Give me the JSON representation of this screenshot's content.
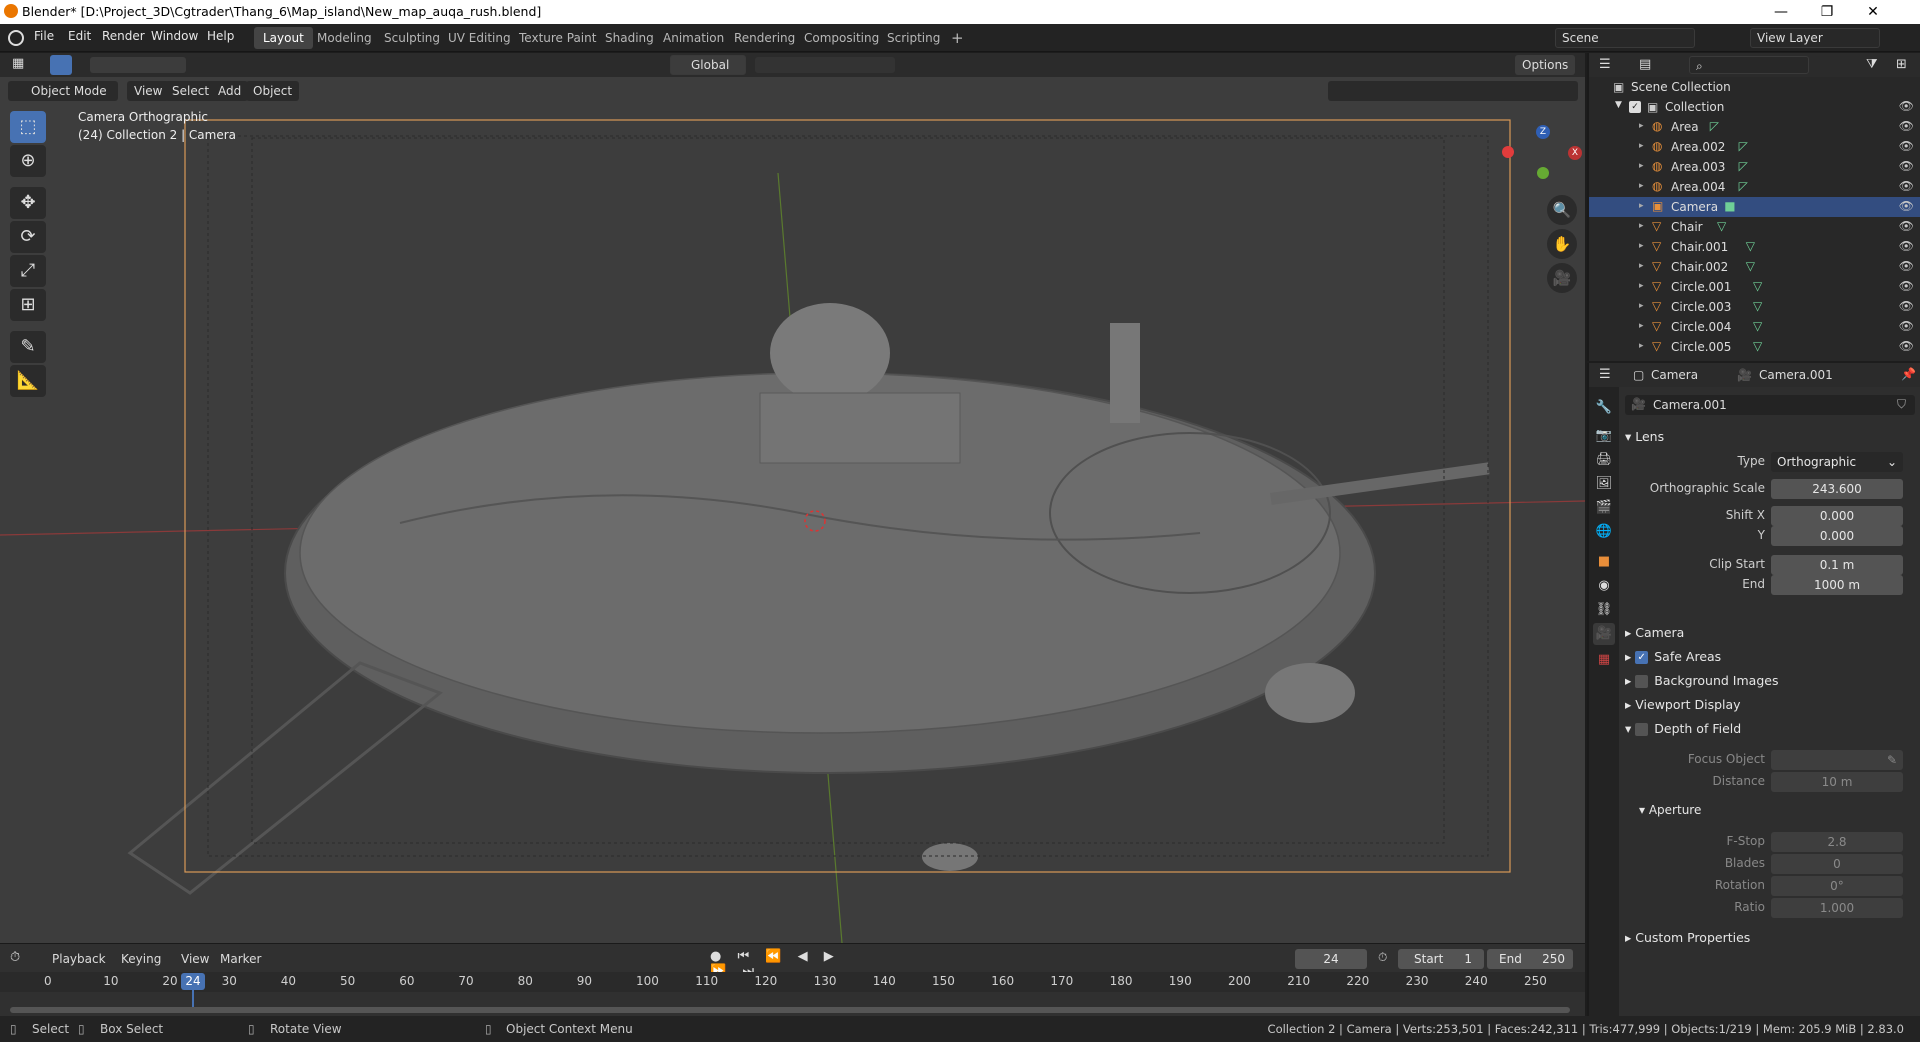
{
  "title_bar": {
    "title": "Blender* [D:\\Project_3D\\Cgtrader\\Thang_6\\Map_island\\New_map_auqa_rush.blend]",
    "minimize": "—",
    "maximize": "❐",
    "close": "✕"
  },
  "menu": [
    "File",
    "Edit",
    "Render",
    "Window",
    "Help"
  ],
  "workspaces": [
    "Layout",
    "Modeling",
    "Sculpting",
    "UV Editing",
    "Texture Paint",
    "Shading",
    "Animation",
    "Rendering",
    "Compositing",
    "Scripting"
  ],
  "add_workspace": "+",
  "scene": {
    "name": "Scene",
    "view_layer": "View Layer"
  },
  "viewport": {
    "mode": "Object Mode",
    "menus": [
      "View",
      "Select",
      "Add",
      "Object"
    ],
    "transform": "Global",
    "options": "Options",
    "overlay_line1": "Camera Orthographic",
    "overlay_line2": "(24) Collection 2 | Camera",
    "gizmo_z": "Z",
    "gizmo_x": "X"
  },
  "timeline": {
    "menus": [
      "Playback",
      "Keying",
      "View",
      "Marker"
    ],
    "current_frame": "24",
    "start_label": "Start",
    "start": "1",
    "end_label": "End",
    "end": "250",
    "ruler": [
      "0",
      "10",
      "20",
      "30",
      "40",
      "50",
      "60",
      "70",
      "80",
      "90",
      "100",
      "110",
      "120",
      "130",
      "140",
      "150",
      "160",
      "170",
      "180",
      "190",
      "200",
      "210",
      "220",
      "230",
      "240",
      "250"
    ],
    "playhead": "24"
  },
  "status_bar": {
    "select": "Select",
    "box_select": "Box Select",
    "rotate_view": "Rotate View",
    "context_menu": "Object Context Menu",
    "stats": "Collection 2 | Camera | Verts:253,501 | Faces:242,311 | Tris:477,999 | Objects:1/219 | Mem: 205.9 MiB | 2.83.0"
  },
  "outliner": {
    "root": "Scene Collection",
    "collection": "Collection",
    "items": [
      {
        "name": "Area"
      },
      {
        "name": "Area.002"
      },
      {
        "name": "Area.003"
      },
      {
        "name": "Area.004"
      },
      {
        "name": "Camera"
      },
      {
        "name": "Chair"
      },
      {
        "name": "Chair.001"
      },
      {
        "name": "Chair.002"
      },
      {
        "name": "Circle.001"
      },
      {
        "name": "Circle.003"
      },
      {
        "name": "Circle.004"
      },
      {
        "name": "Circle.005"
      }
    ],
    "selected_index": 4
  },
  "properties": {
    "breadcrumb_obj": "Camera",
    "breadcrumb_data": "Camera.001",
    "datablock": "Camera.001",
    "lens_header": "Lens",
    "type_label": "Type",
    "type_value": "Orthographic",
    "ortho_label": "Orthographic Scale",
    "ortho_value": "243.600",
    "shiftx_label": "Shift X",
    "shiftx_value": "0.000",
    "shifty_label": "Y",
    "shifty_value": "0.000",
    "clipstart_label": "Clip Start",
    "clipstart_value": "0.1 m",
    "clipend_label": "End",
    "clipend_value": "1000 m",
    "camera_header": "Camera",
    "safe_areas": "Safe Areas",
    "bg_images": "Background Images",
    "viewport_display": "Viewport Display",
    "dof": "Depth of Field",
    "focus_label": "Focus Object",
    "distance_label": "Distance",
    "distance_value": "10 m",
    "aperture_header": "Aperture",
    "fstop_label": "F-Stop",
    "fstop_value": "2.8",
    "blades_label": "Blades",
    "blades_value": "0",
    "rotation_label": "Rotation",
    "rotation_value": "0°",
    "ratio_label": "Ratio",
    "ratio_value": "1.000",
    "custom_props": "Custom Properties"
  }
}
